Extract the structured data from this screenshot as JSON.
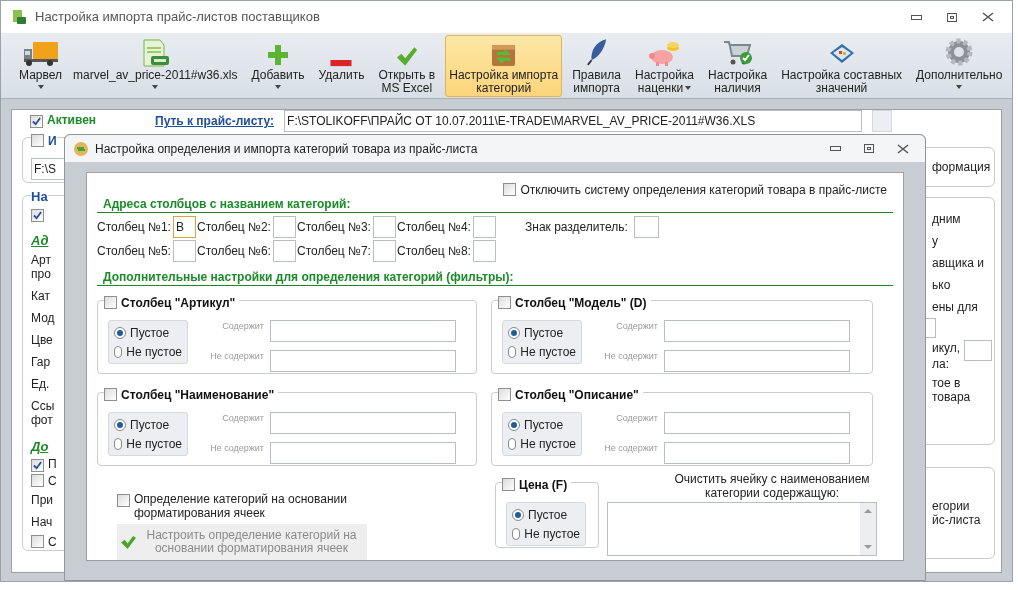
{
  "window": {
    "title": "Настройка импорта прайс-листов поставщиков"
  },
  "toolbar": {
    "items": [
      {
        "lines": [
          "Марвел"
        ],
        "dropdown": true,
        "selected": false
      },
      {
        "lines": [
          "marvel_av_price-2011#w36.xls"
        ],
        "dropdown": true,
        "selected": false
      },
      {
        "lines": [
          "Добавить"
        ],
        "dropdown": true,
        "selected": false
      },
      {
        "lines": [
          "Удалить"
        ],
        "selected": false
      },
      {
        "lines": [
          "Открыть в",
          "MS Excel"
        ],
        "selected": false
      },
      {
        "lines": [
          "Настройка импорта",
          "категорий"
        ],
        "selected": true
      },
      {
        "lines": [
          "Правила",
          "импорта"
        ],
        "selected": false
      },
      {
        "lines": [
          "Настройка",
          "наценки"
        ],
        "dropdown": true,
        "selected": false
      },
      {
        "lines": [
          "Настройка",
          "наличия"
        ],
        "selected": false
      },
      {
        "lines": [
          "Настройка составных",
          "значений"
        ],
        "selected": false
      },
      {
        "lines": [
          "Дополнительно"
        ],
        "dropdown": true,
        "selected": false
      }
    ]
  },
  "background": {
    "active": {
      "label": "Активен",
      "checked": true
    },
    "path_label": "Путь к прайс-листу:",
    "path_value": "F:\\STOLIKOFF\\ПРАЙС ОТ 10.07.2011\\E-TRADE\\MARVEL_AV_PRICE-2011#W36.XLS",
    "group1": {
      "label": "И",
      "checked": false,
      "field_value": "F:\\S"
    },
    "group2": {
      "title": "На",
      "items": [
        {
          "kind": "checkbox",
          "checked": true
        },
        {
          "kind": "heading",
          "lines": [
            "Ад"
          ]
        },
        {
          "kind": "text",
          "lines": [
            "Арт",
            "про"
          ]
        },
        {
          "kind": "text",
          "lines": [
            "Кат"
          ]
        },
        {
          "kind": "text",
          "lines": [
            "Мод"
          ]
        },
        {
          "kind": "text",
          "lines": [
            "Цве"
          ]
        },
        {
          "kind": "text",
          "lines": [
            "Гар"
          ]
        },
        {
          "kind": "text",
          "lines": [
            "Ед."
          ]
        },
        {
          "kind": "text",
          "lines": [
            "Ссы",
            "фот"
          ]
        },
        {
          "kind": "heading",
          "lines": [
            "До"
          ]
        },
        {
          "kind": "checkbox",
          "checked": true,
          "label": "П"
        },
        {
          "kind": "checkbox",
          "checked": false,
          "label": "С"
        },
        {
          "kind": "text",
          "lines": [
            "При"
          ]
        },
        {
          "kind": "text",
          "lines": [
            "Нач"
          ]
        },
        {
          "kind": "checkbox",
          "checked": false,
          "label": "С"
        }
      ]
    },
    "right_groups": [
      {
        "items": [
          {
            "kind": "text",
            "lines": [
              "формация"
            ]
          }
        ]
      },
      {
        "items": [
          {
            "kind": "text",
            "lines": [
              "дним"
            ]
          },
          {
            "kind": "text",
            "lines": [
              "у"
            ]
          },
          {
            "kind": "text",
            "lines": [
              "авщика и"
            ]
          },
          {
            "kind": "text",
            "lines": [
              "ько"
            ]
          },
          {
            "kind": "text",
            "lines": [
              "ены для"
            ]
          },
          {
            "kind": "field"
          },
          {
            "kind": "text_field",
            "lines": [
              "икул,",
              "ла:"
            ]
          },
          {
            "kind": "text",
            "lines": [
              "тое в",
              "товара"
            ]
          }
        ]
      },
      {
        "items": [
          {
            "kind": "text",
            "lines": [
              "егории",
              "йс-листа"
            ]
          }
        ]
      }
    ]
  },
  "dialog": {
    "title": "Настройка определения и импорта категорий товара из прайс-листа",
    "disable": {
      "label": "Отключить систему определения категорий товара в прайс-листе",
      "checked": false
    },
    "columns_heading": "Адреса столбцов с названием категорий:",
    "columns": [
      {
        "label": "Столбец №1:",
        "value": "B",
        "focused": true
      },
      {
        "label": "Столбец №2:",
        "focused": false
      },
      {
        "label": "Столбец №3:",
        "focused": false
      },
      {
        "label": "Столбец №4:",
        "focused": false
      },
      {
        "label": "Столбец №5:",
        "focused": false
      },
      {
        "label": "Столбец №6:",
        "focused": false
      },
      {
        "label": "Столбец №7:",
        "focused": false
      },
      {
        "label": "Столбец №8:",
        "focused": false
      }
    ],
    "separator_label": "Знак разделитель:",
    "filters_heading": "Дополнительные настройки для определения категорий (фильтры):",
    "filters": [
      {
        "kind": "full",
        "title": "Столбец \"Артикул\"",
        "checked": false,
        "options": [
          {
            "label": "Пустое",
            "selected": true
          },
          {
            "label": "Не пустое",
            "selected": false
          }
        ],
        "contains_label": "Содержит",
        "not_contains_label": "Не содержит"
      },
      {
        "kind": "full",
        "title": "Столбец \"Модель\" (D)",
        "checked": false,
        "options": [
          {
            "label": "Пустое",
            "selected": true
          },
          {
            "label": "Не пустое",
            "selected": false
          }
        ],
        "contains_label": "Содержит",
        "not_contains_label": "Не содержит"
      },
      {
        "kind": "full",
        "title": "Столбец \"Наименование\"",
        "checked": false,
        "options": [
          {
            "label": "Пустое",
            "selected": true
          },
          {
            "label": "Не пустое",
            "selected": false
          }
        ],
        "contains_label": "Содержит",
        "not_contains_label": "Не содержит"
      },
      {
        "kind": "full",
        "title": "Столбец \"Описание\"",
        "checked": false,
        "options": [
          {
            "label": "Пустое",
            "selected": true
          },
          {
            "label": "Не пустое",
            "selected": false
          }
        ],
        "contains_label": "Содержит",
        "not_contains_label": "Не содержит"
      },
      {
        "kind": "radio_only",
        "title": "Цена (F)",
        "checked": false,
        "options": [
          {
            "label": "Пустое",
            "selected": true
          },
          {
            "label": "Не пустое",
            "selected": false
          }
        ]
      }
    ],
    "format_checkbox": {
      "label": "Определение категорий на основании форматирования ячеек",
      "checked": false
    },
    "format_button": {
      "label": "Настроить определение категорий на основании форматирования ячеек",
      "disabled": true
    },
    "clear_label": "Очистить ячейку с наименованием категории содержащую:"
  }
}
